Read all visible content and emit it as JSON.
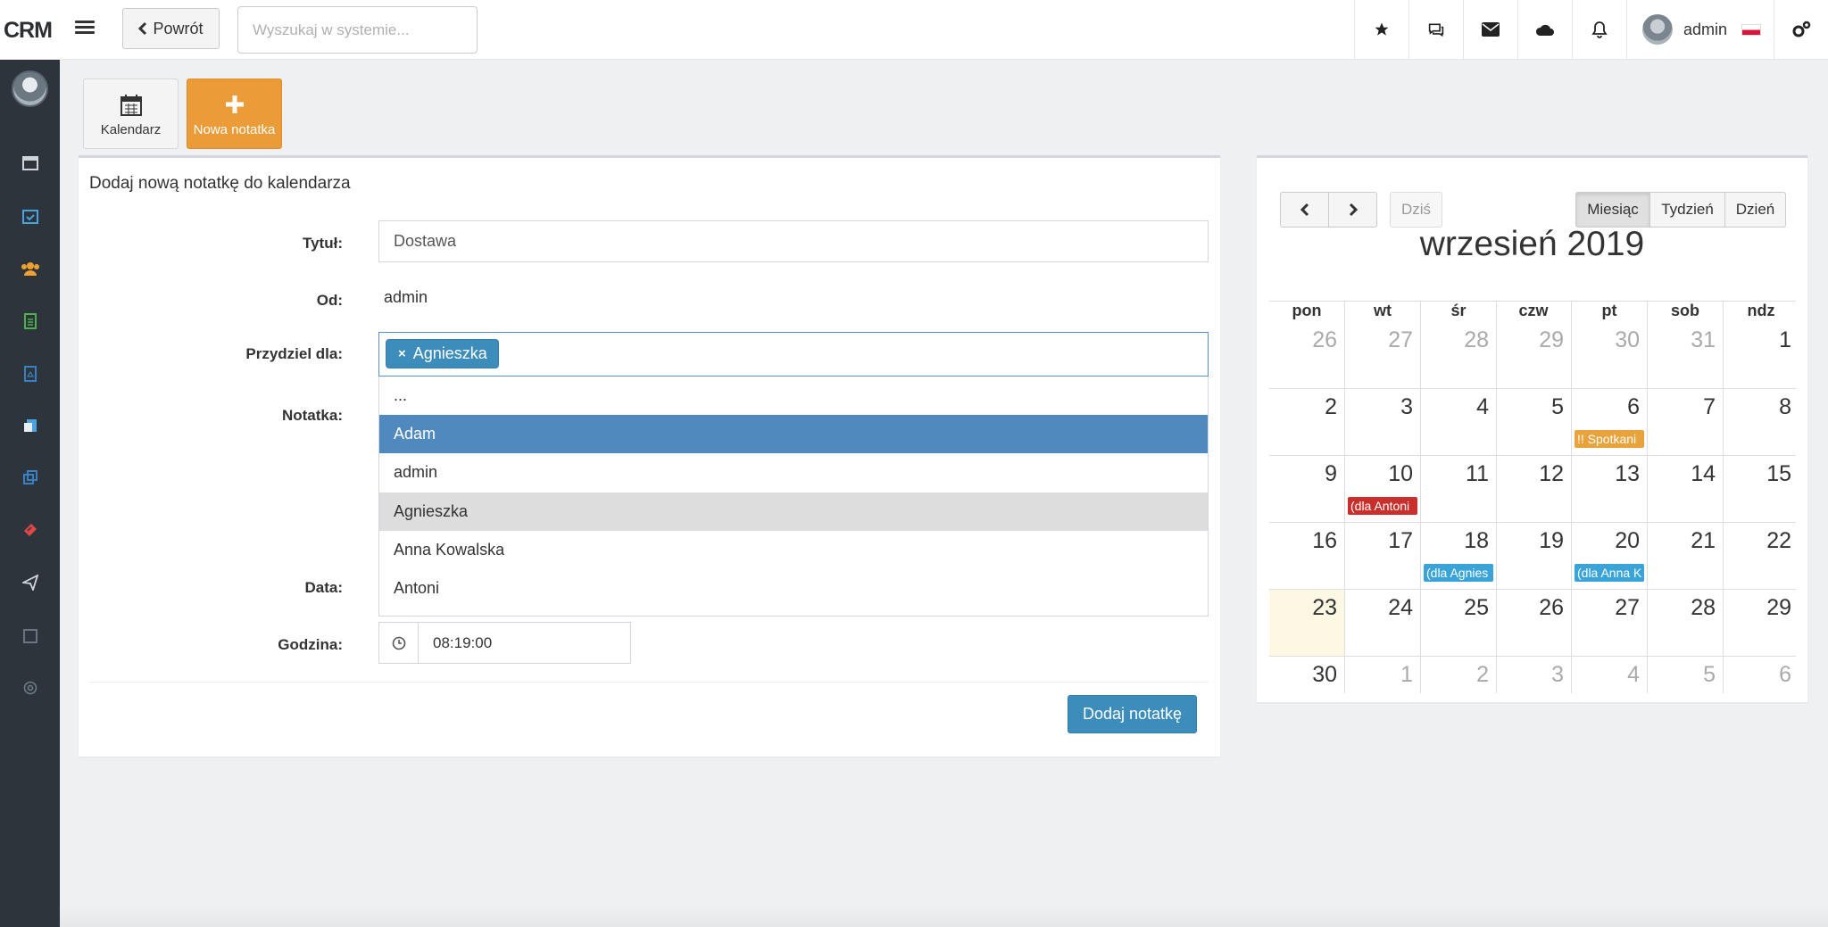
{
  "app": {
    "brand": "CRM"
  },
  "header": {
    "back_label": "Powrót",
    "search_placeholder": "Wyszukaj w systemie...",
    "user_name": "admin"
  },
  "toolbar": {
    "calendar_label": "Kalendarz",
    "new_note_label": "Nowa notatka"
  },
  "form": {
    "title": "Dodaj nową notatkę do kalendarza",
    "labels": {
      "title": "Tytuł:",
      "from": "Od:",
      "assign": "Przydziel dla:",
      "note": "Notatka:",
      "date": "Data:",
      "time": "Godzina:"
    },
    "values": {
      "title": "Dostawa",
      "from": "admin",
      "time": "08:19:00"
    },
    "selected_tag": "Agnieszka",
    "tag_remove": "×",
    "options": [
      "...",
      "Adam",
      "admin",
      "Agnieszka",
      "Anna Kowalska",
      "Antoni"
    ],
    "submit_label": "Dodaj notatkę"
  },
  "calendar": {
    "today_label": "Dziś",
    "views": [
      "Miesiąc",
      "Tydzień",
      "Dzień"
    ],
    "active_view": "Miesiąc",
    "title": "wrzesień 2019",
    "days_of_week": [
      "pon",
      "wt",
      "śr",
      "czw",
      "pt",
      "sob",
      "ndz"
    ],
    "weeks": [
      [
        "26",
        "27",
        "28",
        "29",
        "30",
        "31",
        "1"
      ],
      [
        "2",
        "3",
        "4",
        "5",
        "6",
        "7",
        "8"
      ],
      [
        "9",
        "10",
        "11",
        "12",
        "13",
        "14",
        "15"
      ],
      [
        "16",
        "17",
        "18",
        "19",
        "20",
        "21",
        "22"
      ],
      [
        "23",
        "24",
        "25",
        "26",
        "27",
        "28",
        "29"
      ],
      [
        "30",
        "1",
        "2",
        "3",
        "4",
        "5",
        "6"
      ]
    ],
    "events": [
      {
        "week": 1,
        "day": 4,
        "text": "!! Spotkani",
        "color": "#e8a33d"
      },
      {
        "week": 2,
        "day": 1,
        "text": "(dla Antoni",
        "color": "#c9302c"
      },
      {
        "week": 3,
        "day": 2,
        "text": "(dla Agnies",
        "color": "#3aa3d8"
      },
      {
        "week": 3,
        "day": 4,
        "text": "(dla Anna K",
        "color": "#3aa3d8"
      }
    ]
  },
  "colors": {
    "primary": "#3c8dbc",
    "accent_orange": "#eb9c38",
    "sidebar_bg": "#2d343b",
    "dropdown_highlight": "#5089be",
    "today_bg": "#fcf8e3"
  }
}
